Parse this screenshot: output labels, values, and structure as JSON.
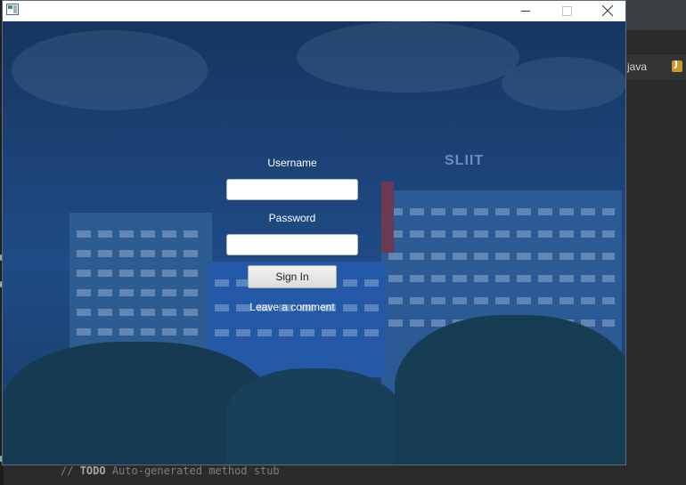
{
  "window": {
    "title": "",
    "controls": {
      "minimize_icon": "minimize-icon",
      "maximize_icon": "maximize-icon",
      "close_icon": "close-icon"
    }
  },
  "background": {
    "sign_text": "SLIIT"
  },
  "login": {
    "username_label": "Username",
    "username_value": "",
    "password_label": "Password",
    "password_value": "",
    "signin_label": "Sign In",
    "comment_link": "Leave a comment"
  },
  "ide": {
    "tab_label": "java",
    "code_line": {
      "comment": "// ",
      "keyword": "TODO",
      "text": " Auto-generated method stub"
    }
  },
  "colors": {
    "overlay": "#1a3f73",
    "titlebar": "#ffffff",
    "ide_background": "#2b2b2b"
  }
}
